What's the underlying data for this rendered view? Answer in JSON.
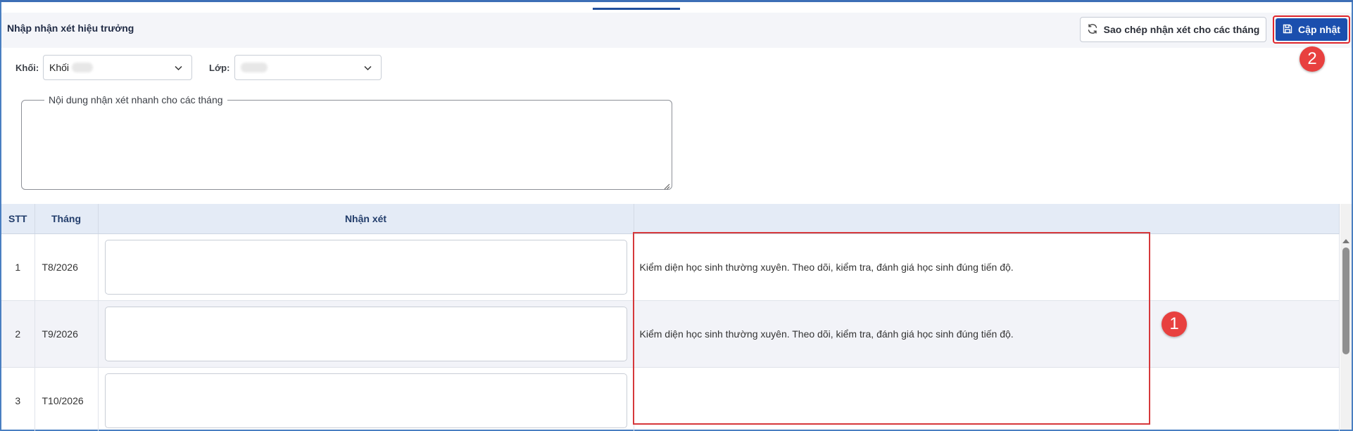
{
  "header": {
    "title": "Nhập nhận xét hiệu trưởng",
    "copy_button_label": "Sao chép nhận xét cho các tháng",
    "update_button_label": "Cập nhật"
  },
  "annotations": {
    "badge_1": "1",
    "badge_2": "2"
  },
  "filters": {
    "grade_label": "Khối:",
    "grade_value": "Khối",
    "class_label": "Lớp:"
  },
  "quick_comment": {
    "legend": "Nội dung nhận xét nhanh cho các tháng",
    "value": ""
  },
  "table": {
    "headers": {
      "stt": "STT",
      "month": "Tháng",
      "comment": "Nhận xét",
      "extra": ""
    },
    "rows": [
      {
        "stt": "1",
        "month": "T8/2026",
        "comment": "",
        "suggestion": "Kiểm diện học sinh thường xuyên. Theo dõi, kiểm tra, đánh giá học sinh đúng tiến độ."
      },
      {
        "stt": "2",
        "month": "T9/2026",
        "comment": "",
        "suggestion": "Kiểm diện học sinh thường xuyên. Theo dõi, kiểm tra, đánh giá học sinh đúng tiến độ."
      },
      {
        "stt": "3",
        "month": "T10/2026",
        "comment": "",
        "suggestion": ""
      }
    ]
  },
  "colors": {
    "primary": "#1b4fae",
    "highlight": "#d6383b",
    "badge": "#e8403f",
    "table_header_bg": "#e4ebf6"
  },
  "icons": {
    "copy": "refresh-icon",
    "update": "save-icon",
    "dropdown": "chevron-down-icon"
  }
}
